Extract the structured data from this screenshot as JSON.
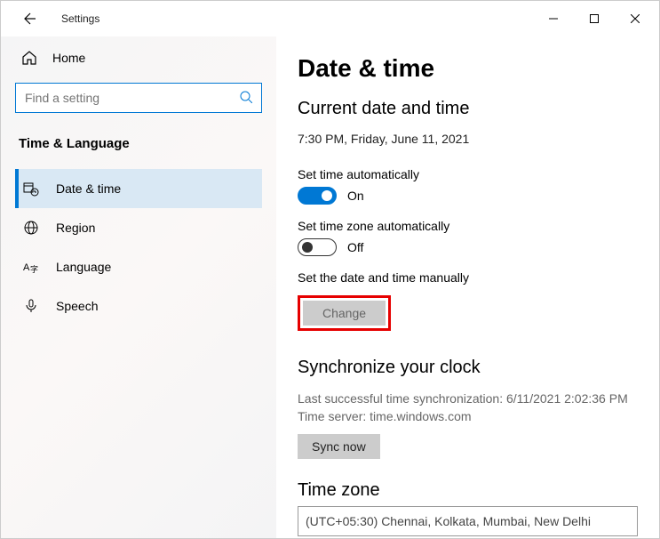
{
  "titlebar": {
    "title": "Settings"
  },
  "sidebar": {
    "home": "Home",
    "search_placeholder": "Find a setting",
    "section": "Time & Language",
    "items": [
      {
        "label": "Date & time"
      },
      {
        "label": "Region"
      },
      {
        "label": "Language"
      },
      {
        "label": "Speech"
      }
    ]
  },
  "content": {
    "title": "Date & time",
    "subtitle": "Current date and time",
    "now": "7:30 PM, Friday, June 11, 2021",
    "auto_time_label": "Set time automatically",
    "auto_time_state": "On",
    "auto_tz_label": "Set time zone automatically",
    "auto_tz_state": "Off",
    "manual_label": "Set the date and time manually",
    "change_button": "Change",
    "sync_title": "Synchronize your clock",
    "sync_line1": "Last successful time synchronization: 6/11/2021 2:02:36 PM",
    "sync_line2": "Time server: time.windows.com",
    "sync_button": "Sync now",
    "tz_title": "Time zone",
    "tz_value": "(UTC+05:30) Chennai, Kolkata, Mumbai, New Delhi"
  }
}
